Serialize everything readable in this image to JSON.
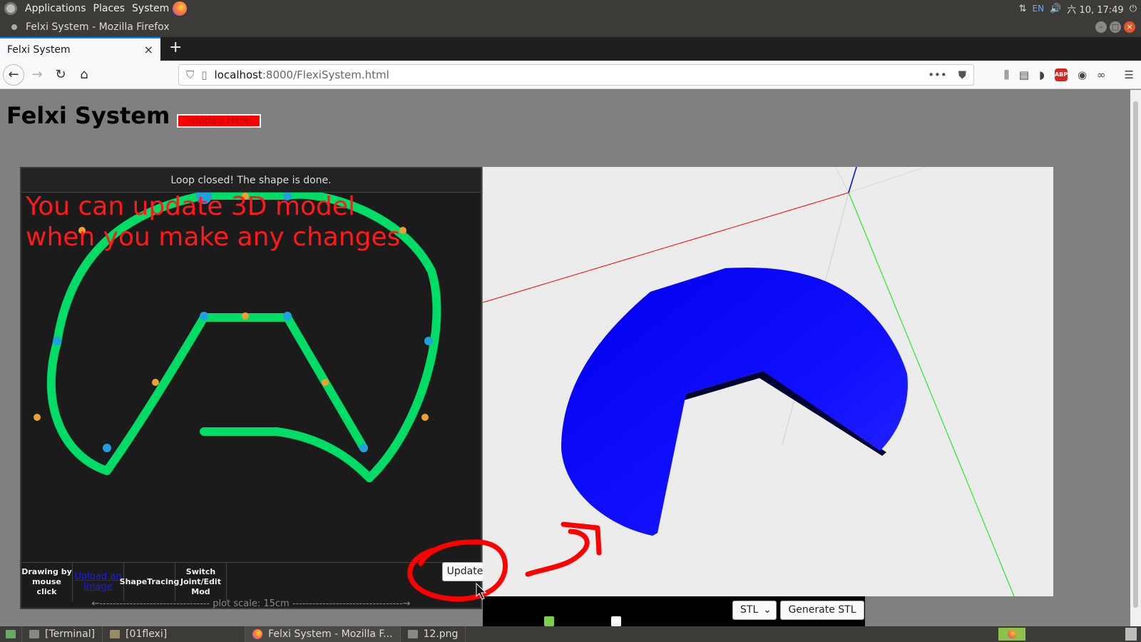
{
  "top_panel": {
    "menus": [
      "Applications",
      "Places",
      "System"
    ],
    "locale": "EN",
    "clock": "六 10, 17:49"
  },
  "window": {
    "title": "Felxi System - Mozilla Firefox"
  },
  "browser": {
    "tab_title": "Felxi System",
    "url_host": "localhost",
    "url_path": ":8000/FlexiSystem.html",
    "abp_label": "ABP"
  },
  "page": {
    "title": "Felxi System",
    "tutorial_button": "Tutorials Here!",
    "status": "Loop closed! The shape is done.",
    "annotation_line1": "You can update 3D model",
    "annotation_line2": "when you make any changes",
    "tools": [
      {
        "label": "Drawing by mouse click"
      },
      {
        "label": "Upload an image"
      },
      {
        "label": "ShapeTracing"
      },
      {
        "label": "Switch Joint/Edit Mod"
      }
    ],
    "update_button": "Update",
    "scale_text": "plot scale: 15cm",
    "export_format": "STL",
    "generate_button": "Generate STL",
    "checkbox_checked": true,
    "checkbox2_checked": false
  },
  "taskbar": {
    "items": [
      "[Terminal]",
      "[01flexi]",
      "Felxi System - Mozilla F...",
      "12.png"
    ]
  },
  "colors": {
    "shape_stroke": "#00dd66",
    "joint": "#1fa0e0",
    "control_point": "#f0a030",
    "model": "#0a00ff",
    "annotation": "#ff1a1a"
  }
}
